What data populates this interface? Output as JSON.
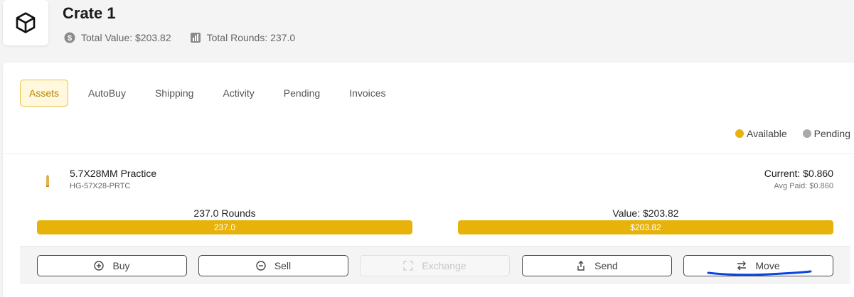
{
  "header": {
    "title": "Crate 1",
    "total_value": "Total Value: $203.82",
    "total_rounds": "Total Rounds: 237.0"
  },
  "tabs": [
    {
      "label": "Assets",
      "active": true
    },
    {
      "label": "AutoBuy",
      "active": false
    },
    {
      "label": "Shipping",
      "active": false
    },
    {
      "label": "Activity",
      "active": false
    },
    {
      "label": "Pending",
      "active": false
    },
    {
      "label": "Invoices",
      "active": false
    }
  ],
  "legend": {
    "available": "Available",
    "pending": "Pending"
  },
  "colors": {
    "accent": "#e7b30b",
    "available": "#e7b30b",
    "pending": "#a9a9a9"
  },
  "asset": {
    "name": "5.7X28MM Practice",
    "sku": "HG-57X28-PRTC",
    "current": "Current: $0.860",
    "avg_paid": "Avg Paid: $0.860",
    "rounds_label": "237.0 Rounds",
    "rounds_bar_text": "237.0",
    "rounds_fill": 1.0,
    "value_label": "Value: $203.82",
    "value_bar_text": "$203.82",
    "value_fill": 1.0
  },
  "actions": {
    "buy": "Buy",
    "sell": "Sell",
    "exchange": "Exchange",
    "send": "Send",
    "move": "Move"
  },
  "icons": [
    "box-icon",
    "dollar-icon",
    "bar-chart-icon",
    "bullet-icon",
    "plus-circle-icon",
    "minus-circle-icon",
    "expand-icon",
    "share-icon",
    "swap-icon"
  ]
}
